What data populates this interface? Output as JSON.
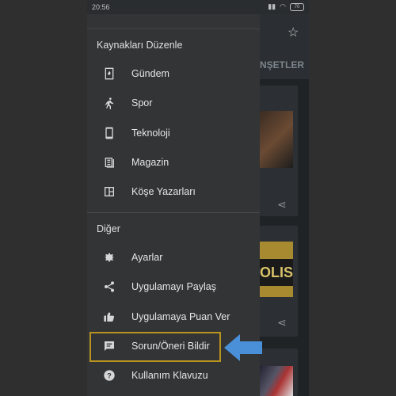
{
  "status": {
    "time": "20:56",
    "battery": "70"
  },
  "background": {
    "tab_label": "NŞETLER",
    "img2_text": "OLIS"
  },
  "drawer": {
    "section_sources": "Kaynakları Düzenle",
    "section_other": "Diğer",
    "sources": [
      {
        "label": "Gündem",
        "icon": "fire-icon"
      },
      {
        "label": "Spor",
        "icon": "running-icon"
      },
      {
        "label": "Teknoloji",
        "icon": "phone-icon"
      },
      {
        "label": "Magazin",
        "icon": "book-icon"
      },
      {
        "label": "Köşe Yazarları",
        "icon": "columns-icon"
      }
    ],
    "others": [
      {
        "label": "Ayarlar",
        "icon": "gear-icon"
      },
      {
        "label": "Uygulamayı Paylaş",
        "icon": "share-icon"
      },
      {
        "label": "Uygulamaya Puan Ver",
        "icon": "thumbs-up-icon"
      },
      {
        "label": "Sorun/Öneri Bildir",
        "icon": "feedback-icon"
      },
      {
        "label": "Kullanım Klavuzu",
        "icon": "help-icon"
      }
    ]
  },
  "colors": {
    "highlight": "#b8941f",
    "arrow": "#4a90d9"
  }
}
